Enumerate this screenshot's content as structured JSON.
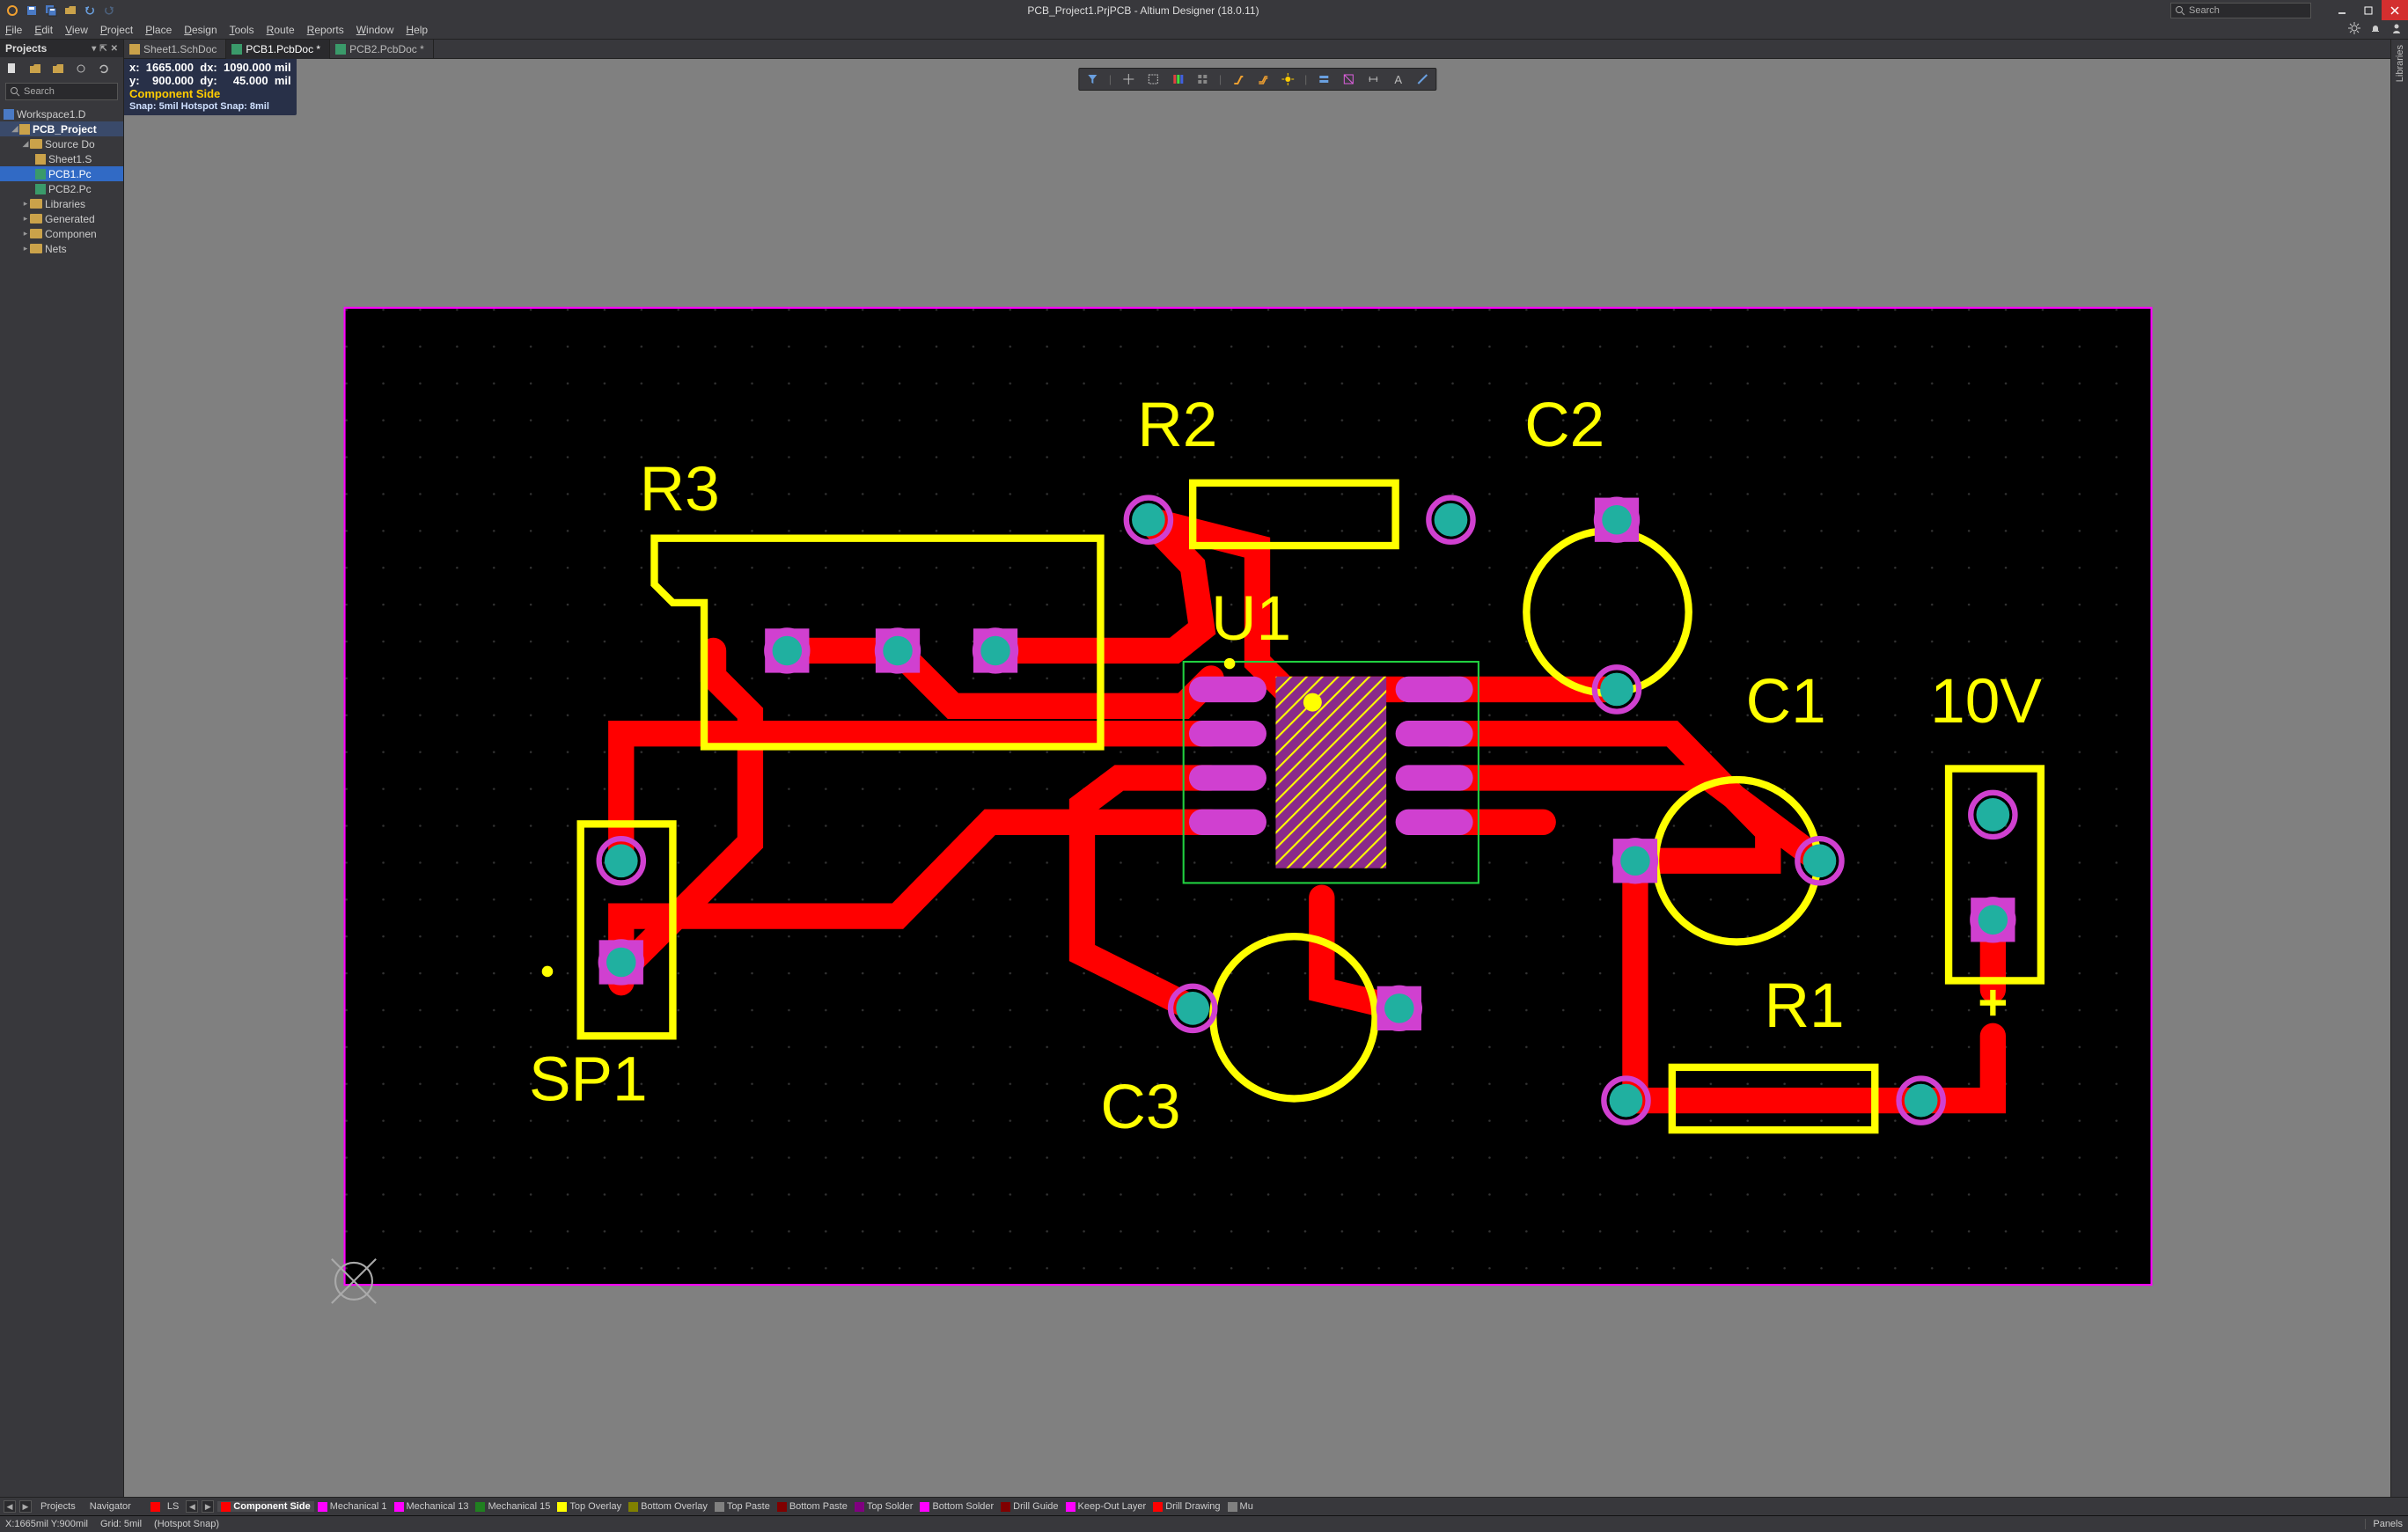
{
  "titlebar": {
    "title": "PCB_Project1.PrjPCB - Altium Designer (18.0.11)",
    "search_placeholder": "Search",
    "quick_icons": [
      "logo",
      "save",
      "save-all",
      "open",
      "undo",
      "redo"
    ]
  },
  "menu": {
    "items": [
      "File",
      "Edit",
      "View",
      "Project",
      "Place",
      "Design",
      "Tools",
      "Route",
      "Reports",
      "Window",
      "Help"
    ],
    "right_icons": [
      "settings",
      "notifications",
      "account"
    ]
  },
  "projects_panel": {
    "title": "Projects",
    "search_placeholder": "Search",
    "toolbar_icons": [
      "new",
      "open",
      "save",
      "refresh",
      "settings"
    ],
    "tree": {
      "workspace": "Workspace1.D",
      "project": "PCB_Project",
      "project_selected": true,
      "source_docs_label": "Source Do",
      "files": [
        {
          "name": "Sheet1.S",
          "type": "sch"
        },
        {
          "name": "PCB1.Pc",
          "type": "pcb",
          "selected": true
        },
        {
          "name": "PCB2.Pc",
          "type": "pcb"
        }
      ],
      "folders": [
        "Libraries",
        "Generated",
        "Componen",
        "Nets"
      ]
    }
  },
  "tabs": [
    {
      "label": "Sheet1.SchDoc",
      "type": "sch",
      "active": false,
      "dirty": false
    },
    {
      "label": "PCB1.PcbDoc",
      "type": "pcb",
      "active": true,
      "dirty": true
    },
    {
      "label": "PCB2.PcbDoc",
      "type": "pcb",
      "active": false,
      "dirty": true
    }
  ],
  "hud": {
    "x": "1665.000",
    "dx": "1090.000",
    "unit": "mil",
    "y": "900.000",
    "dy": "45.000",
    "layer_label": "Component Side",
    "snap_line": "Snap: 5mil Hotspot Snap: 8mil"
  },
  "float_toolbar": {
    "icons": [
      "filter",
      "crosshair",
      "select-rect",
      "align",
      "array",
      "route",
      "diff-pair",
      "highlight-net",
      "via",
      "dimension",
      "drc",
      "text",
      "line"
    ]
  },
  "right_panel": {
    "label": "Libraries"
  },
  "layers_bar": {
    "nav_tabs": [
      "Projects",
      "Navigator"
    ],
    "ls_label": "LS",
    "items": [
      {
        "name": "Component Side",
        "color": "#ff0000",
        "active": true
      },
      {
        "name": "Mechanical 1",
        "color": "#ff00ff"
      },
      {
        "name": "Mechanical 13",
        "color": "#ff00ff"
      },
      {
        "name": "Mechanical 15",
        "color": "#208020"
      },
      {
        "name": "Top Overlay",
        "color": "#ffff00"
      },
      {
        "name": "Bottom Overlay",
        "color": "#808000"
      },
      {
        "name": "Top Paste",
        "color": "#808080"
      },
      {
        "name": "Bottom Paste",
        "color": "#800000"
      },
      {
        "name": "Top Solder",
        "color": "#800080"
      },
      {
        "name": "Bottom Solder",
        "color": "#ff00ff"
      },
      {
        "name": "Drill Guide",
        "color": "#800000"
      },
      {
        "name": "Keep-Out Layer",
        "color": "#ff00ff"
      },
      {
        "name": "Drill Drawing",
        "color": "#ff0000"
      },
      {
        "name": "Mu",
        "color": "#808080"
      }
    ]
  },
  "status": {
    "coords": "X:1665mil Y:900mil",
    "grid": "Grid: 5mil",
    "snap": "(Hotspot Snap)",
    "panels_btn": "Panels"
  },
  "pcb": {
    "designators": [
      "R1",
      "R2",
      "R3",
      "C1",
      "C2",
      "C3",
      "U1",
      "SP1",
      "10V"
    ],
    "board_extent_mil": [
      1960,
      1045
    ]
  }
}
